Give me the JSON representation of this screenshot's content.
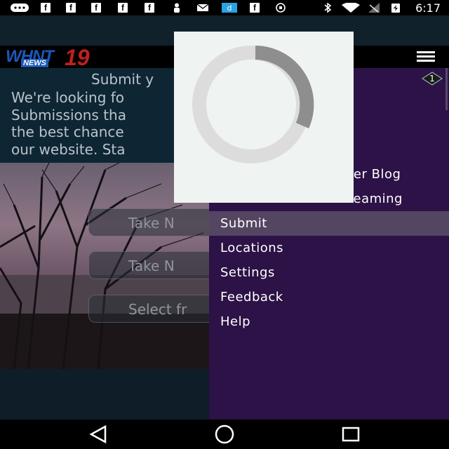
{
  "status_bar": {
    "time": "6:17",
    "notification_icons": [
      "chat-icon",
      "facebook-icon",
      "facebook-icon",
      "facebook-icon",
      "facebook-icon",
      "facebook-icon",
      "person-icon",
      "mail-icon",
      "d-app-icon",
      "facebook-icon",
      "circle-icon"
    ],
    "system_icons": [
      "bluetooth-icon",
      "wifi-icon",
      "signal-icon",
      "battery-charging-icon"
    ]
  },
  "header": {
    "logo_text": "WHNT",
    "logo_number": "19",
    "logo_sub": "NEWS"
  },
  "intro": {
    "title": "Submit y",
    "lines": [
      "We're looking fo",
      "Submissions tha",
      "the best chance",
      "our website. Sta"
    ]
  },
  "actions": [
    {
      "label": "Take N"
    },
    {
      "label": "Take N"
    },
    {
      "label": "Select fr"
    }
  ],
  "drawer": {
    "badge_count": "1",
    "partial_items": [
      {
        "label": "t"
      },
      {
        "label": "her Blog"
      },
      {
        "label": "reaming"
      }
    ],
    "items": [
      {
        "label": "Submit",
        "active": true
      },
      {
        "label": "Locations",
        "active": false
      },
      {
        "label": "Settings",
        "active": false
      },
      {
        "label": "Feedback",
        "active": false
      },
      {
        "label": "Help",
        "active": false
      }
    ]
  },
  "loading": {
    "icon": "loading-spinner-icon"
  },
  "nav_bar": {
    "icons": [
      "back-icon",
      "home-icon",
      "recents-icon"
    ]
  },
  "colors": {
    "drawer_bg": "#2c1246",
    "drawer_active": "#544663",
    "intro_bg": "#0e2634",
    "logo_blue": "#1b57b8",
    "logo_red": "#c21f1f"
  }
}
